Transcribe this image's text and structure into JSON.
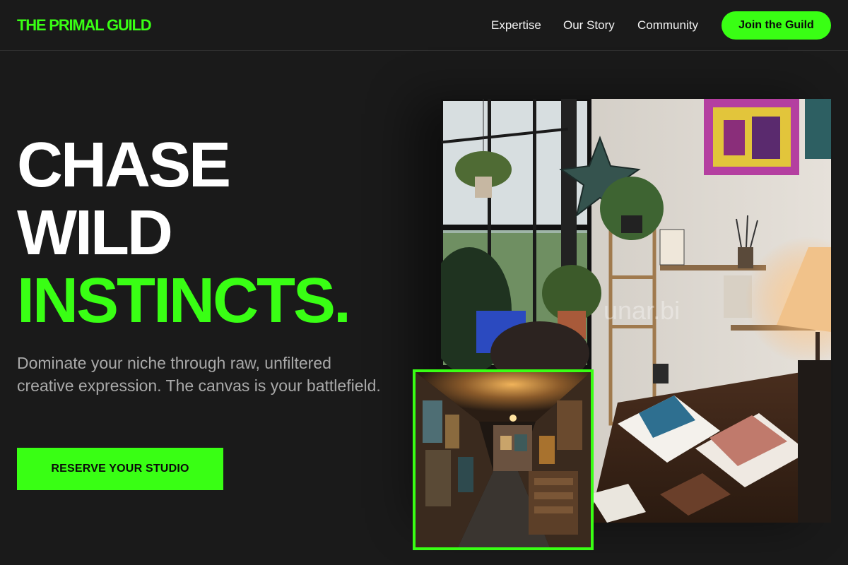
{
  "header": {
    "logo": "THE PRIMAL GUILD",
    "nav": [
      {
        "label": "Expertise"
      },
      {
        "label": "Our Story"
      },
      {
        "label": "Community"
      }
    ],
    "cta_label": "Join the Guild"
  },
  "hero": {
    "headline_line1": "CHASE",
    "headline_line2": "WILD",
    "headline_line3": "INSTINCTS.",
    "subtext": "Dominate your niche through raw, unfiltered creative expression. The canvas is your battlefield.",
    "cta_label": "RESERVE YOUR STUDIO"
  },
  "images": {
    "main_image": "art-studio-photo",
    "inset_image": "gallery-corridor-photo",
    "watermark": "unar.bi"
  },
  "colors": {
    "accent": "#39ff14",
    "background": "#1a1a1a",
    "subtext": "#a9a9a9"
  }
}
